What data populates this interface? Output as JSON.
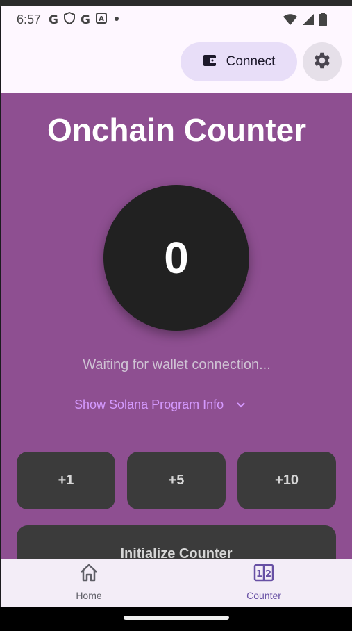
{
  "status_bar": {
    "time": "6:57",
    "left_icons": [
      "google-icon",
      "shield-icon",
      "google-icon",
      "a-icon",
      "dot-icon"
    ],
    "right_icons": [
      "wifi-icon",
      "signal-icon",
      "battery-icon"
    ]
  },
  "app_bar": {
    "connect_label": "Connect",
    "connect_icon": "wallet-icon",
    "settings_icon": "gear-icon"
  },
  "main": {
    "title": "Onchain Counter",
    "counter_value": "0",
    "status_text": "Waiting for wallet connection...",
    "program_info_label": "Show Solana Program Info",
    "increment_buttons": [
      "+1",
      "+5",
      "+10"
    ],
    "initialize_label": "Initialize Counter"
  },
  "bottom_nav": {
    "items": [
      {
        "label": "Home",
        "icon": "home-icon",
        "selected": false
      },
      {
        "label": "Counter",
        "icon": "counter-icon",
        "selected": true
      }
    ]
  },
  "colors": {
    "content_bg": "#8e4f91",
    "accent": "#6750a4",
    "button_bg": "#3b3b3b",
    "link": "#d59aff"
  }
}
